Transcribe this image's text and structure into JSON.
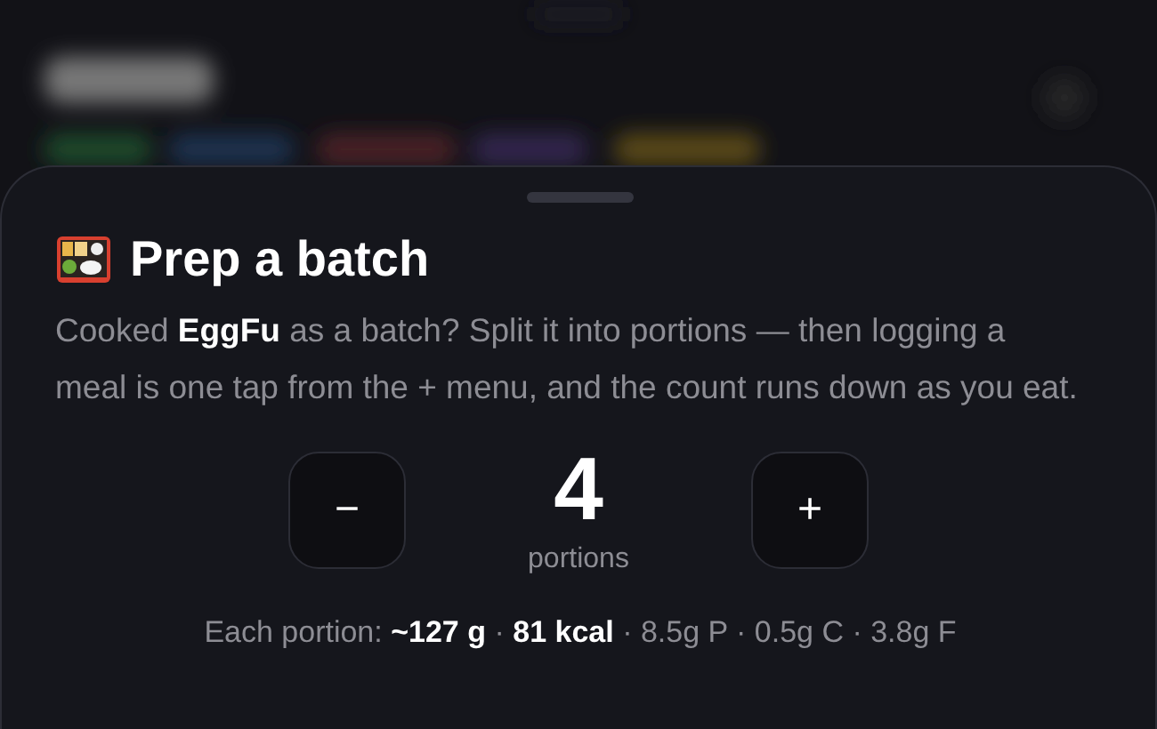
{
  "sheet": {
    "title": "Prep a batch",
    "description": "Cooked **EggFu** as a batch? Split it into portions — then logging a meal is one tap from the + menu, and the count runs down as you eat.",
    "stepper": {
      "decrement": "−",
      "count": "4",
      "unit": "portions",
      "increment": "+"
    },
    "summary": "Each portion: **~127 g** · **81 kcal** · 8.5g P · 0.5g C · 3.8g F"
  }
}
